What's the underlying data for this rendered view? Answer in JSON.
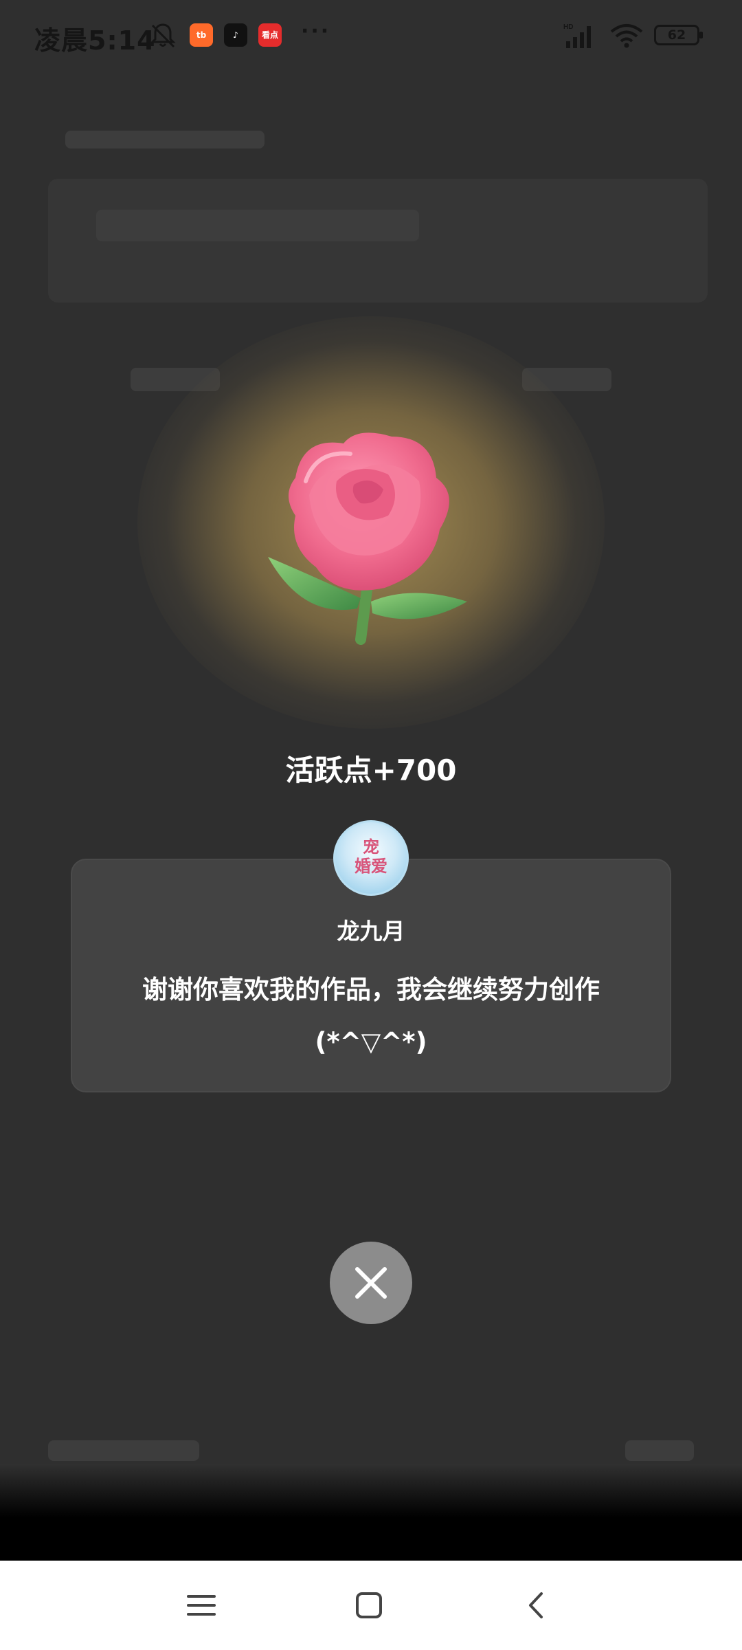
{
  "status_bar": {
    "time": "凌晨5:14",
    "apps": [
      "taobao-icon",
      "tiktok-icon",
      "kandian-icon"
    ],
    "app_badges": [
      "tb",
      "♪",
      "看点"
    ],
    "more": "···",
    "network": "HD",
    "battery": "62"
  },
  "reward": {
    "points_text": "活跃点+700"
  },
  "author": {
    "name": "龙九月",
    "avatar_text": "宠\n婚爱",
    "message": "谢谢你喜欢我的作品，我会继续努力创作(*^▽^*)"
  },
  "colors": {
    "background": "#2f2f2f",
    "card": "#434343",
    "close_button": "#8c8c8c",
    "glow": "#aa9155",
    "rose": "#f06b8e"
  },
  "icons": {
    "close": "close-icon",
    "nav_menu": "menu-icon",
    "nav_home": "home-icon",
    "nav_back": "back-icon"
  }
}
